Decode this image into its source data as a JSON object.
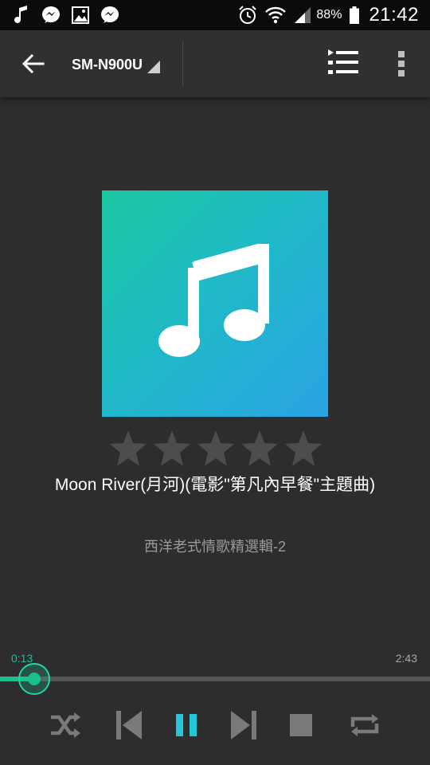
{
  "status_bar": {
    "icons": [
      "music-note-icon",
      "messenger-icon",
      "gallery-icon",
      "messenger-icon",
      "alarm-icon",
      "wifi-icon",
      "signal-icon",
      "battery-icon"
    ],
    "battery": "88%",
    "time": "21:42"
  },
  "app_bar": {
    "device_name": "SM-N900U"
  },
  "track": {
    "title": "Moon River(月河)(電影\"第凡內早餐\"主題曲)",
    "album": "西洋老式情歌精選輯-2",
    "rating_stars": 5,
    "rating_value": 0
  },
  "playback": {
    "elapsed": "0:13",
    "duration": "2:43",
    "progress_fraction": 0.08,
    "state": "playing"
  },
  "colors": {
    "accent": "#1dbf8e",
    "pause_accent": "#26c6da",
    "background": "#2d2d2f",
    "controls_grey": "#7a7a7c",
    "star_grey": "#4d4d4f"
  }
}
